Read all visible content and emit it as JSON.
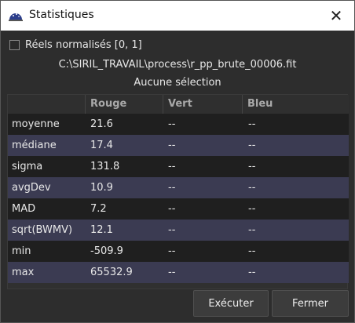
{
  "window": {
    "title": "Statistiques",
    "close_glyph": "✕"
  },
  "checkbox": {
    "label": "Réels normalisés [0, 1]",
    "checked": false
  },
  "file_path": "C:\\SIRIL_TRAVAIL\\process\\r_pp_brute_00006.fit",
  "selection_status": "Aucune sélection",
  "table": {
    "headers": [
      "",
      "Rouge",
      "Vert",
      "Bleu"
    ],
    "rows": [
      [
        "moyenne",
        "21.6",
        "--",
        "--"
      ],
      [
        "médiane",
        "17.4",
        "--",
        "--"
      ],
      [
        "sigma",
        "131.8",
        "--",
        "--"
      ],
      [
        "avgDev",
        "10.9",
        "--",
        "--"
      ],
      [
        "MAD",
        "7.2",
        "--",
        "--"
      ],
      [
        "sqrt(BWMV)",
        "12.1",
        "--",
        "--"
      ],
      [
        "min",
        "-509.9",
        "--",
        "--"
      ],
      [
        "max",
        "65532.9",
        "--",
        "--"
      ]
    ]
  },
  "buttons": {
    "execute": "Exécuter",
    "close": "Fermer"
  },
  "colors": {
    "row_odd": "#1f1f1f",
    "row_even": "#3b3b52",
    "header_text": "#a8a8a8"
  }
}
